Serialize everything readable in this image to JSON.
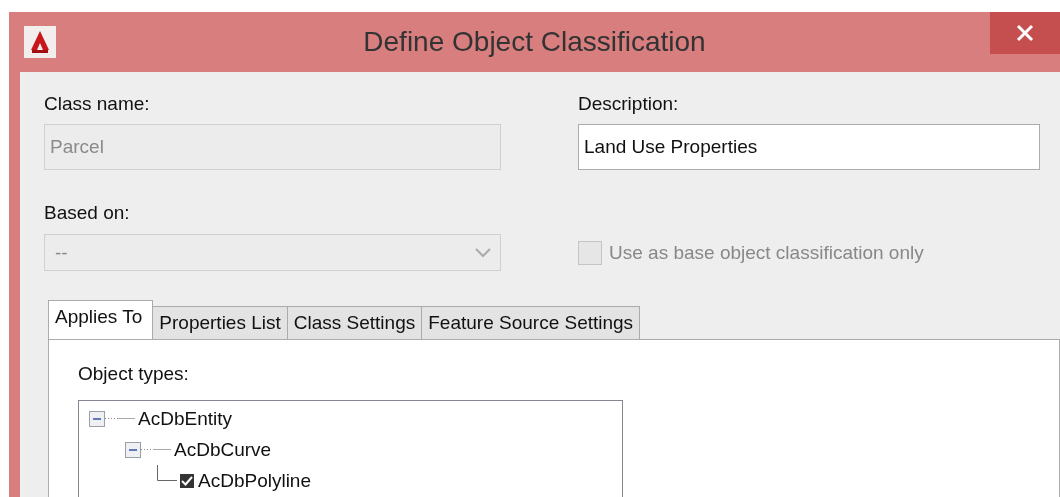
{
  "window": {
    "title": "Define Object Classification"
  },
  "class_name": {
    "label": "Class name:",
    "value": "Parcel",
    "disabled": true
  },
  "description": {
    "label": "Description:",
    "value": "Land Use Properties",
    "disabled": false
  },
  "based_on": {
    "label": "Based on:",
    "value": "--",
    "disabled": true
  },
  "base_only": {
    "label": "Use as base object classification only",
    "checked": false,
    "disabled": true
  },
  "tabs": [
    {
      "label": "Applies To",
      "selected": true
    },
    {
      "label": "Properties List",
      "selected": false
    },
    {
      "label": "Class Settings",
      "selected": false
    },
    {
      "label": "Feature Source Settings",
      "selected": false
    }
  ],
  "object_types": {
    "label": "Object types:",
    "tree": [
      {
        "label": "AcDbEntity",
        "expanded": true,
        "children": [
          {
            "label": "AcDbCurve",
            "expanded": true,
            "children": [
              {
                "label": "AcDbPolyline",
                "checked": true
              }
            ]
          }
        ]
      }
    ]
  }
}
